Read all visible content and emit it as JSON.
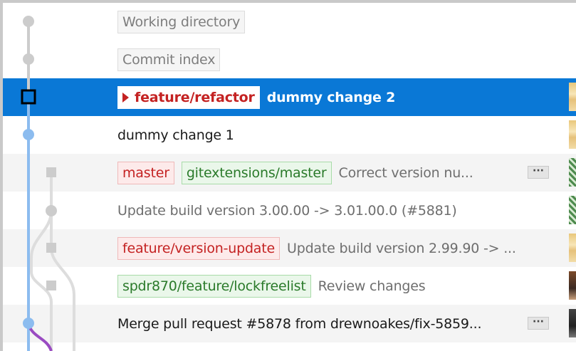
{
  "colors": {
    "selection": "#0a78d6",
    "graph_main": "#8cbcef",
    "graph_other": "#cccccc",
    "graph_merge": "#9a4bc2",
    "local_branch": "#c42222",
    "remote_branch": "#2a7a2a"
  },
  "rows": [
    {
      "labels": [
        {
          "kind": "pseudo",
          "text": "Working directory"
        }
      ],
      "message": "",
      "has_more": false,
      "avatar": "none"
    },
    {
      "labels": [
        {
          "kind": "pseudo",
          "text": "Commit index"
        }
      ],
      "message": "",
      "has_more": false,
      "avatar": "none"
    },
    {
      "labels": [
        {
          "kind": "head",
          "text": "feature/refactor"
        }
      ],
      "message": "dummy change 2",
      "has_more": false,
      "avatar": "tan",
      "selected": true
    },
    {
      "labels": [],
      "message": "dummy change 1",
      "has_more": false,
      "avatar": "tan"
    },
    {
      "labels": [
        {
          "kind": "local",
          "text": "master"
        },
        {
          "kind": "remote",
          "text": "gitextensions/master"
        }
      ],
      "message": "Correct version nu...",
      "has_more": true,
      "avatar": "green"
    },
    {
      "labels": [],
      "message": "Update build version 3.00.00 -> 3.01.00.0 (#5881)",
      "has_more": false,
      "avatar": "green",
      "muted": true
    },
    {
      "labels": [
        {
          "kind": "local",
          "text": "feature/version-update"
        }
      ],
      "message": "Update build version 2.99.90 -> ...",
      "has_more": false,
      "avatar": "tan",
      "muted": true
    },
    {
      "labels": [
        {
          "kind": "remote",
          "text": "spdr870/feature/lockfreelist"
        }
      ],
      "message": "Review changes",
      "has_more": false,
      "avatar": "photo",
      "muted": true
    },
    {
      "labels": [],
      "message": "Merge pull request #5878 from drewnoakes/fix-5859...",
      "has_more": true,
      "avatar": "dark"
    }
  ],
  "more_label": "···",
  "icons": {
    "head_marker": "triangle-right-icon",
    "more": "ellipsis-icon"
  }
}
